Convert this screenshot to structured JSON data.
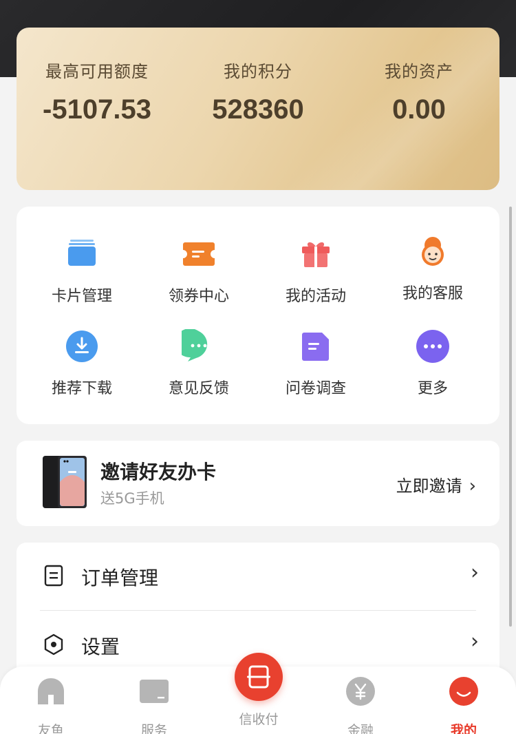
{
  "summary": {
    "stats": [
      {
        "label": "最高可用额度",
        "value": "-5107.53"
      },
      {
        "label": "我的积分",
        "value": "528360"
      },
      {
        "label": "我的资产",
        "value": "0.00"
      }
    ]
  },
  "services": {
    "items": [
      {
        "label": "卡片管理",
        "icon": "card-icon"
      },
      {
        "label": "领券中心",
        "icon": "coupon-icon"
      },
      {
        "label": "我的活动",
        "icon": "gift-icon"
      },
      {
        "label": "我的客服",
        "icon": "customer-service-icon"
      },
      {
        "label": "推荐下载",
        "icon": "download-icon"
      },
      {
        "label": "意见反馈",
        "icon": "feedback-icon"
      },
      {
        "label": "问卷调查",
        "icon": "survey-icon"
      },
      {
        "label": "更多",
        "icon": "more-icon"
      }
    ]
  },
  "invite": {
    "title": "邀请好友办卡",
    "subtitle": "送5G手机",
    "cta": "立即邀请"
  },
  "menu": {
    "items": [
      {
        "label": "订单管理",
        "icon": "order-icon"
      },
      {
        "label": "设置",
        "icon": "settings-icon"
      }
    ]
  },
  "tabbar": {
    "tabs": [
      {
        "label": "友鱼",
        "icon": "home-icon"
      },
      {
        "label": "服务",
        "icon": "service-icon"
      },
      {
        "label": "信收付",
        "icon": "scan-icon"
      },
      {
        "label": "金融",
        "icon": "yuan-icon"
      },
      {
        "label": "我的",
        "icon": "me-icon"
      }
    ],
    "active_color": "#e83a2a"
  },
  "colors": {
    "accent": "#e8412f",
    "gold_card": "#ecd6ad"
  }
}
